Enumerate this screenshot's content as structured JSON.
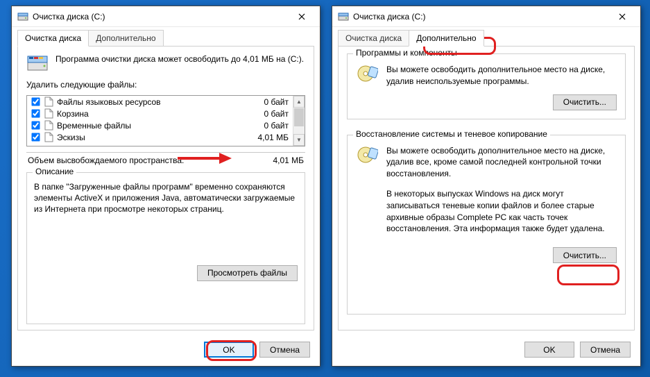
{
  "left": {
    "title": "Очистка диска  (C:)",
    "tabs": {
      "cleanup": "Очистка диска",
      "advanced": "Дополнительно"
    },
    "intro": "Программа очистки диска может освободить до 4,01 МБ на  (C:).",
    "files_label": "Удалить следующие файлы:",
    "files": [
      {
        "name": "Файлы языковых ресурсов",
        "size": "0 байт",
        "checked": true
      },
      {
        "name": "Корзина",
        "size": "0 байт",
        "checked": true
      },
      {
        "name": "Временные файлы",
        "size": "0 байт",
        "checked": true
      },
      {
        "name": "Эскизы",
        "size": "4,01 МБ",
        "checked": true
      }
    ],
    "total_label": "Объем высвобождаемого пространства:",
    "total_value": "4,01 МБ",
    "desc_title": "Описание",
    "desc_text": "В папке \"Загруженные файлы программ\" временно сохраняются элементы ActiveX и приложения Java, автоматически загружаемые из Интернета при просмотре некоторых страниц.",
    "view_files": "Просмотреть файлы",
    "ok": "OK",
    "cancel": "Отмена"
  },
  "right": {
    "title": "Очистка диска  (C:)",
    "tabs": {
      "cleanup": "Очистка диска",
      "advanced": "Дополнительно"
    },
    "group1_title": "Программы и компоненты",
    "group1_text": "Вы можете освободить дополнительное место на диске, удалив неиспользуемые программы.",
    "group2_title": "Восстановление системы и теневое копирование",
    "group2_text1": "Вы можете освободить дополнительное место на диске, удалив все, кроме самой последней контрольной точки восстановления.",
    "group2_text2": "В некоторых выпусках Windows на диск могут записываться теневые копии файлов и более старые архивные образы Complete PC как часть точек восстановления. Эта информация также будет удалена.",
    "clean": "Очистить...",
    "ok": "OK",
    "cancel": "Отмена"
  }
}
